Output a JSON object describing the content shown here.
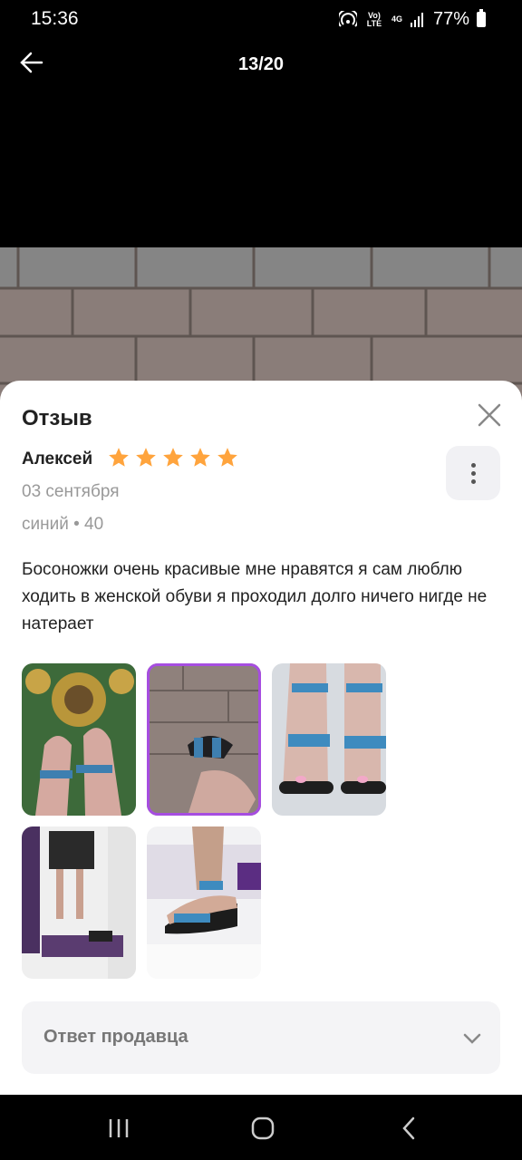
{
  "status_bar": {
    "time": "15:36",
    "battery": "77%",
    "volte": "Vo) LTE",
    "network": "4G"
  },
  "top_bar": {
    "counter": "13/20"
  },
  "review": {
    "title": "Отзыв",
    "author": "Алексей",
    "rating": 5,
    "date": "03 сентября",
    "variant": "синий • 40",
    "text": "Босоножки очень красивые мне нравятся я сам люблю ходить в женской обуви я проходил долго ничего нигде не натерает"
  },
  "seller_answer": {
    "label": "Ответ продавца"
  },
  "colors": {
    "star": "#ffa43d",
    "selected_outline": "#a64de0"
  }
}
